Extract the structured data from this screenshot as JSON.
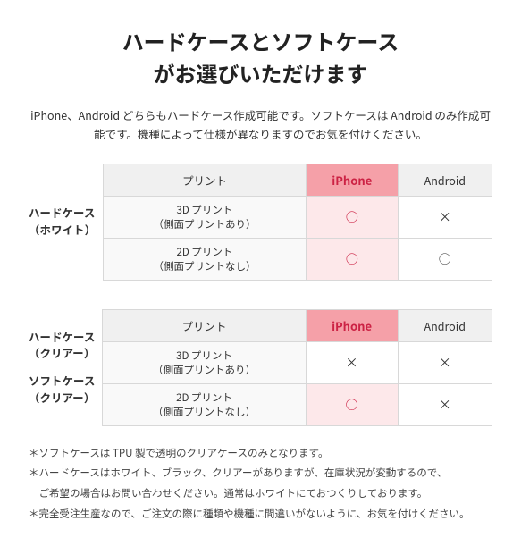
{
  "title": {
    "line1": "ハードケースとソフトケース",
    "line2": "がお選びいただけます"
  },
  "intro": "iPhone、Android どちらもハードケース作成可能です。ソフトケースは\nAndroid のみ作成可能です。機種によって仕様が異なりますのでお気を付けください。",
  "table1": {
    "rowHeader": "ハードケース\n（ホワイト）",
    "headers": [
      "プリント",
      "iPhone",
      "Android"
    ],
    "rows": [
      {
        "print": "3D プリント\n（側面プリントあり）",
        "iphone": "○",
        "android": "×"
      },
      {
        "print": "2D プリント\n（側面プリントなし）",
        "iphone": "○",
        "android": "○"
      }
    ]
  },
  "table2": {
    "rowHeader1": "ハードケース\n（クリアー）",
    "rowHeader2": "ソフトケース\n（クリアー）",
    "headers": [
      "プリント",
      "iPhone",
      "Android"
    ],
    "rows": [
      {
        "print": "3D プリント\n（側面プリントあり）",
        "iphone": "×",
        "android": "×"
      },
      {
        "print": "2D プリント\n（側面プリントなし）",
        "iphone": "○",
        "android": "×"
      }
    ]
  },
  "notes": [
    "＊ソフトケースは TPU 製で透明のクリアケースのみとなります。",
    "＊ハードケースはホワイト、ブラック、クリアーがありますが、在庫状況が変動するので、",
    "　ご希望の場合はお問い合わせください。通常はホワイトにておつくりしております。",
    "＊完全受注生産なので、ご注文の際に種類や機種に間違いがないように、お気を付けください。"
  ]
}
